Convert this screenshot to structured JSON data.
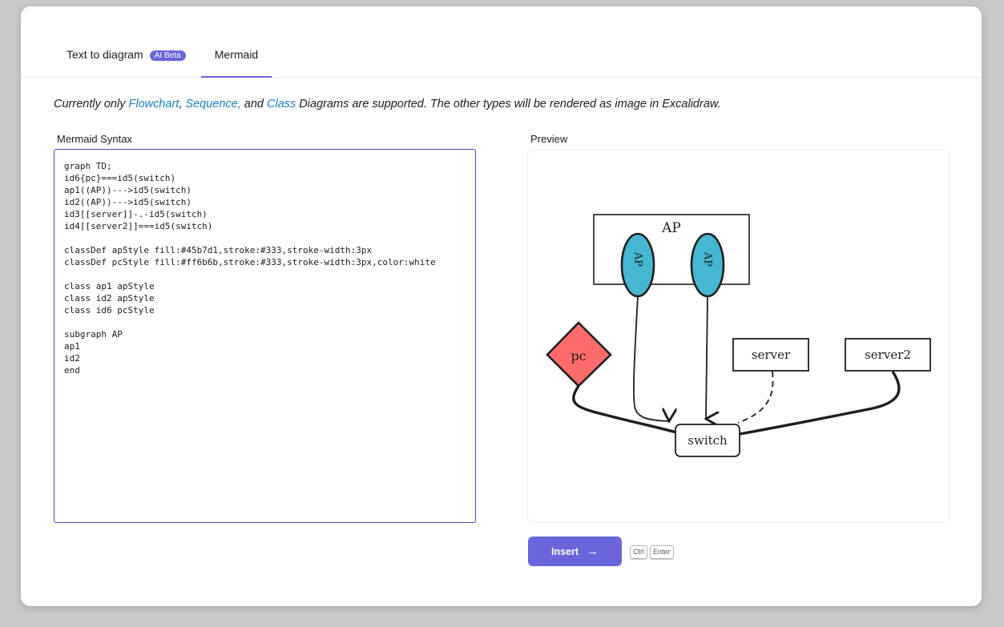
{
  "tabs": [
    {
      "label": "Text to diagram",
      "badge": "AI Beta"
    },
    {
      "label": "Mermaid"
    }
  ],
  "note": {
    "prefix": "Currently only ",
    "flowchart": "Flowchart",
    "comma1": ", ",
    "sequence": "Sequence,",
    "and": " and ",
    "class": "Class",
    "suffix": " Diagrams are supported. The other types will be rendered as image in Excalidraw."
  },
  "editor": {
    "label": "Mermaid Syntax",
    "code": "graph TD;\nid6{pc}===id5(switch)\nap1((AP))--->id5(switch)\nid2((AP))--->id5(switch)\nid3[[server]]-.-id5(switch)\nid4[[server2]]===id5(switch)\n\nclassDef apStyle fill:#45b7d1,stroke:#333,stroke-width:3px\nclassDef pcStyle fill:#ff6b6b,stroke:#333,stroke-width:3px,color:white\n\nclass ap1 apStyle\nclass id2 apStyle\nclass id6 pcStyle\n\nsubgraph AP\nap1\nid2\nend"
  },
  "preview": {
    "label": "Preview",
    "diagram": {
      "subgraph_label": "AP",
      "ap1_label": "AP",
      "ap2_label": "AP",
      "pc_label": "pc",
      "server_label": "server",
      "server2_label": "server2",
      "switch_label": "switch",
      "ap_fill": "#45b7d1",
      "pc_fill": "#ff6b6b",
      "stroke": "#1e1e1e"
    }
  },
  "actions": {
    "insert_label": "Insert",
    "insert_icon": "arrow-right-icon",
    "shortcut_keys": [
      "Ctrl",
      "Enter"
    ]
  },
  "colors": {
    "accent": "#6965db",
    "link": "#1f7cc2"
  }
}
